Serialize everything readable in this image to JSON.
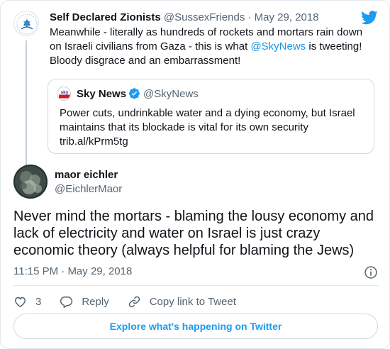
{
  "parent_tweet": {
    "display_name": "Self Declared Zionists",
    "handle": "@SussexFriends",
    "separator": "·",
    "date": "May 29, 2018",
    "text_before": "Meanwhile - literally as hundreds of rockets and mortars rain down on Israeli civilians from Gaza - this is what ",
    "mention": "@SkyNews",
    "text_after": " is tweeting! Bloody disgrace and an embarrassment!"
  },
  "quoted_tweet": {
    "display_name": "Sky News",
    "handle": "@SkyNews",
    "text": "Power cuts, undrinkable water and a dying economy, but Israel maintains that its blockade is vital for its own security trib.al/kPrm5tg"
  },
  "main_tweet": {
    "display_name": "maor eichler",
    "handle": "@EichlerMaor",
    "text": "Never mind the mortars - blaming the lousy economy and lack of electricity and water on Israel is just crazy economic theory (always helpful for blaming the Jews)",
    "time": "11:15 PM",
    "separator": "·",
    "date": "May 29, 2018"
  },
  "actions": {
    "like_count": "3",
    "reply_label": "Reply",
    "copy_link_label": "Copy link to Tweet"
  },
  "explore_label": "Explore what's happening on Twitter",
  "colors": {
    "link_blue": "#1b95e0",
    "twitter_blue": "#1d9bf0",
    "verified_blue": "#1d9bf0",
    "sky_red": "#d71920"
  }
}
